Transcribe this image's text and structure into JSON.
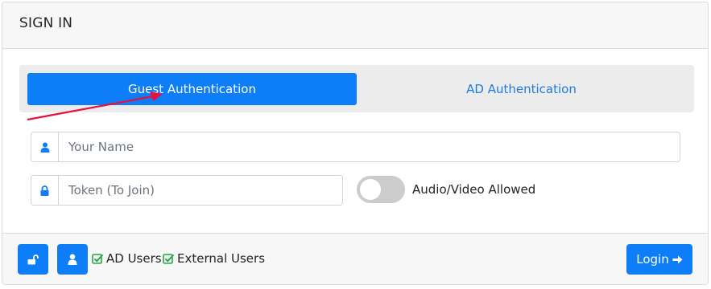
{
  "header": {
    "title": "SIGN IN"
  },
  "tabs": [
    {
      "label": "Guest Authentication",
      "active": true
    },
    {
      "label": "AD Authentication",
      "active": false
    }
  ],
  "form": {
    "name_placeholder": "Your Name",
    "name_value": "",
    "token_placeholder": "Token (To Join)",
    "token_value": "",
    "toggle_label": "Audio/Video Allowed",
    "toggle_on": false
  },
  "footer": {
    "checks": [
      {
        "label": "AD Users",
        "checked": true
      },
      {
        "label": "External Users",
        "checked": true
      }
    ],
    "login_label": "Login"
  },
  "colors": {
    "primary": "#0d7ef8",
    "link": "#1f7ce0",
    "check": "#28a745",
    "annotation_arrow": "#e8103c",
    "toggle_off": "#cccccc"
  },
  "icons": [
    "user-icon",
    "lock-icon",
    "unlock-icon",
    "checkbox-checked-icon",
    "arrow-right-icon"
  ]
}
